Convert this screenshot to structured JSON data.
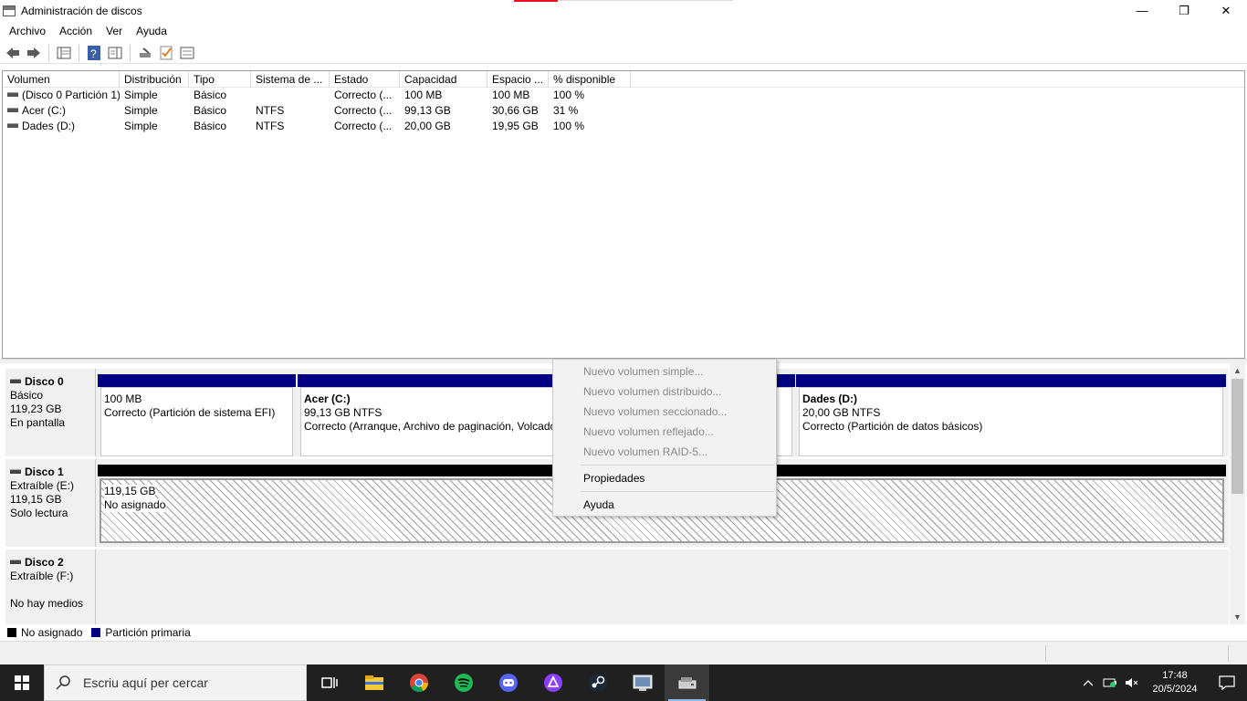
{
  "window": {
    "title": "Administración de discos",
    "minimize": "—",
    "restore": "❐",
    "close": "✕"
  },
  "menu": [
    "Archivo",
    "Acción",
    "Ver",
    "Ayuda"
  ],
  "volume_table": {
    "columns": [
      "Volumen",
      "Distribución",
      "Tipo",
      "Sistema de ...",
      "Estado",
      "Capacidad",
      "Espacio ...",
      "% disponible"
    ],
    "rows": [
      [
        "(Disco 0 Partición 1)",
        "Simple",
        "Básico",
        "",
        "Correcto (...",
        "100 MB",
        "100 MB",
        "100 %"
      ],
      [
        "Acer (C:)",
        "Simple",
        "Básico",
        "NTFS",
        "Correcto (...",
        "99,13 GB",
        "30,66 GB",
        "31 %"
      ],
      [
        "Dades (D:)",
        "Simple",
        "Básico",
        "NTFS",
        "Correcto (...",
        "20,00 GB",
        "19,95 GB",
        "100 %"
      ]
    ]
  },
  "disks": [
    {
      "name": "Disco 0",
      "line1": "Básico",
      "line2": "119,23 GB",
      "line3": "En pantalla",
      "partitions": [
        {
          "name": "",
          "size": "100 MB",
          "status": "Correcto (Partición de sistema EFI)"
        },
        {
          "name": "Acer  (C:)",
          "size": "99,13 GB NTFS",
          "status": "Correcto (Arranque, Archivo de paginación, Volcado"
        },
        {
          "name": "Dades  (D:)",
          "size": "20,00 GB NTFS",
          "status": "Correcto (Partición de datos básicos)"
        }
      ]
    },
    {
      "name": "Disco 1",
      "line1": "Extraíble (E:)",
      "line2": "119,15 GB",
      "line3": "Solo lectura",
      "unallocated": {
        "size": "119,15 GB",
        "label": "No asignado"
      }
    },
    {
      "name": "Disco 2",
      "line1": "Extraíble (F:)",
      "line2": "",
      "line3": "No hay medios"
    }
  ],
  "legend": [
    {
      "label": "No asignado",
      "color": "#000000"
    },
    {
      "label": "Partición primaria",
      "color": "#000080"
    }
  ],
  "context_menu": {
    "items": [
      {
        "label": "Nuevo volumen simple...",
        "enabled": false
      },
      {
        "label": "Nuevo volumen distribuido...",
        "enabled": false
      },
      {
        "label": "Nuevo volumen seccionado...",
        "enabled": false
      },
      {
        "label": "Nuevo volumen reflejado...",
        "enabled": false
      },
      {
        "label": "Nuevo volumen RAID-5...",
        "enabled": false
      },
      {
        "label": "Propiedades",
        "enabled": true
      },
      {
        "label": "Ayuda",
        "enabled": true
      }
    ]
  },
  "taskbar": {
    "search_placeholder": "Escriu aquí per cercar",
    "apps": [
      "task-view-icon",
      "file-explorer-icon",
      "chrome-icon",
      "spotify-icon",
      "discord-icon",
      "proton-vpn-icon",
      "steam-icon",
      "control-panel-icon",
      "disk-management-icon"
    ],
    "time": "17:48",
    "date": "20/5/2024"
  }
}
